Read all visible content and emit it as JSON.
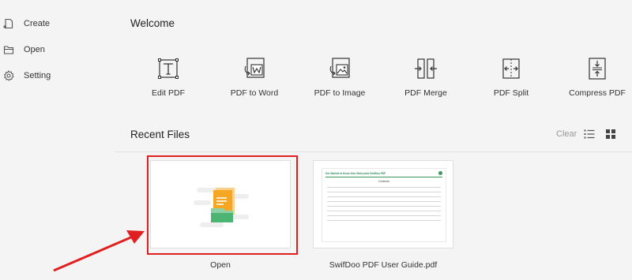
{
  "sidebar": {
    "items": [
      {
        "label": "Create",
        "icon": "create-icon"
      },
      {
        "label": "Open",
        "icon": "folder-icon"
      },
      {
        "label": "Setting",
        "icon": "gear-icon"
      }
    ]
  },
  "main": {
    "welcome": "Welcome",
    "tools": [
      {
        "label": "Edit PDF",
        "icon": "text-edit-icon"
      },
      {
        "label": "PDF to Word",
        "icon": "word-convert-icon"
      },
      {
        "label": "PDF to Image",
        "icon": "image-convert-icon"
      },
      {
        "label": "PDF Merge",
        "icon": "merge-icon"
      },
      {
        "label": "PDF Split",
        "icon": "split-icon"
      },
      {
        "label": "Compress PDF",
        "icon": "compress-icon"
      }
    ],
    "recent": {
      "title": "Recent Files",
      "clear_label": "Clear",
      "files": [
        {
          "label": "Open",
          "type": "open-placeholder"
        },
        {
          "label": "SwifDoo PDF User Guide.pdf",
          "type": "document",
          "doc_heading": "Get Started to Know Your Most-used SwifDoo PDF",
          "doc_subtitle": "Contents"
        }
      ]
    }
  },
  "colors": {
    "background": "#f4f4f4",
    "highlight": "#e02020",
    "accent_green": "#3c9a5f",
    "icon_orange": "#f5a623"
  }
}
